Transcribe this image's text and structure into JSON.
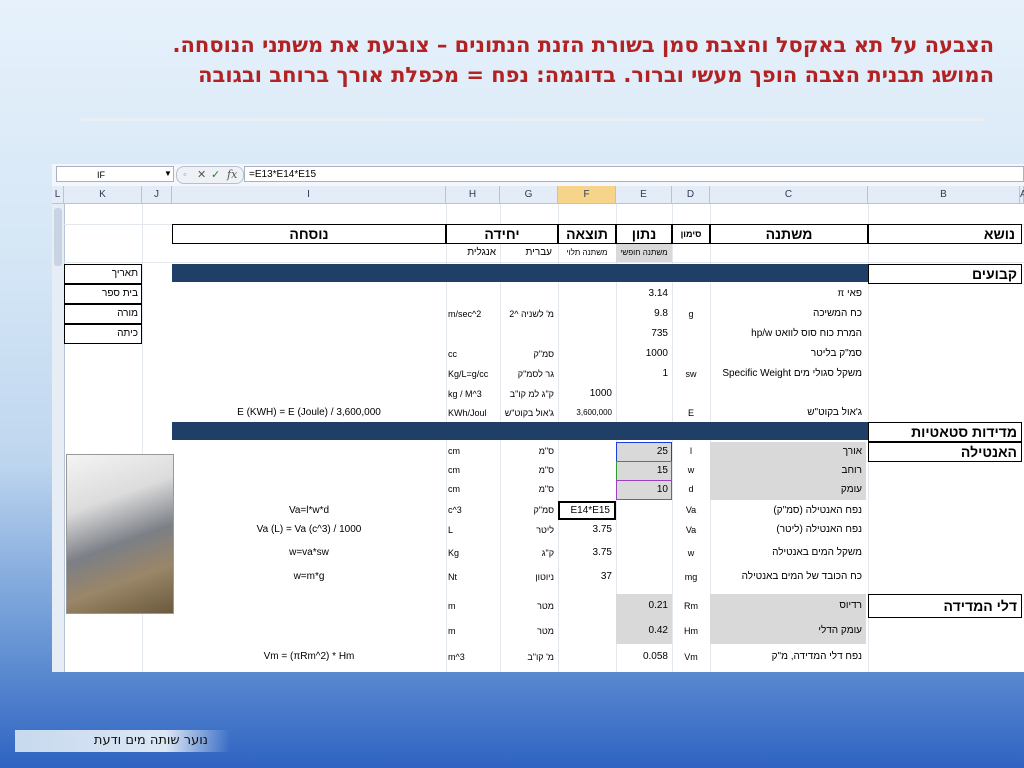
{
  "slide": {
    "title_line1": "הצבעה על תא באקסל והצבת סמן בשורת הזנת הנתונים – צובעת את משתני הנוסחה.",
    "title_line2": "המושג תבנית הצבה הופך מעשי וברור. בדוגמה: נפח = מכפלת אורך ברוחב ובגובה",
    "footer": "נוער שותה מים ודעת",
    "accent_title_color": "#b22222",
    "band_color": "#1f3f66"
  },
  "excel": {
    "name_box": "IF",
    "fx_buttons": [
      "✕",
      "✓",
      "fx"
    ],
    "formula": "=E13*E14*E15",
    "columns": [
      "L",
      "K",
      "J",
      "I",
      "H",
      "G",
      "F",
      "E",
      "D",
      "C",
      "B",
      "A"
    ],
    "headers": {
      "formula": "נוסחה",
      "unit": "יחידה",
      "result": "תוצאה",
      "datum": "נתון",
      "symbol": "סימון",
      "variable": "משתנה",
      "topic": "נושא"
    },
    "subheaders": {
      "english": "אנגלית",
      "hebrew": "עברית",
      "dependent": "משתנה תלוי",
      "free": "משתנה חופשי"
    },
    "side_labels": [
      "תאריך",
      "בית ספר",
      "מורה",
      "כיתה"
    ],
    "topics": {
      "constants": "קבועים",
      "static": "מדידות סטאטיות",
      "antila": "האנטילה",
      "bucket": "דלי המדידה"
    },
    "rows": [
      {
        "variable": "פאי   π",
        "symbol": "",
        "datum": "3.14",
        "result": "",
        "heb": "",
        "eng": "",
        "formula": ""
      },
      {
        "variable": "כח המשיכה",
        "symbol": "g",
        "datum": "9.8",
        "result": "",
        "heb": "מ' לשניה ^2",
        "eng": "m/sec^2",
        "formula": ""
      },
      {
        "variable": "המרת כוח סוס לוואט hp/w",
        "symbol": "",
        "datum": "735",
        "result": "",
        "heb": "",
        "eng": "",
        "formula": ""
      },
      {
        "variable": "סמ\"ק בליטר",
        "symbol": "",
        "datum": "1000",
        "result": "",
        "heb": "סמ\"ק",
        "eng": "cc",
        "formula": ""
      },
      {
        "variable": "משקל סגולי מים Specific Weight",
        "symbol": "sw",
        "datum": "1",
        "result": "",
        "heb": "גר לסמ\"ק",
        "eng": "Kg/L=g/cc",
        "formula": ""
      },
      {
        "variable": "",
        "symbol": "",
        "datum": "",
        "result": "1000",
        "heb": "ק\"ג למ קו\"ב",
        "eng": "kg / M^3",
        "formula": ""
      },
      {
        "variable": "ג'אול בקוט\"ש",
        "symbol": "E",
        "datum": "",
        "result": "3,600,000",
        "heb": "ג'אול בקוט\"ש",
        "eng": "KWh/Joul",
        "formula": "E (KWH) = E (Joule) / 3,600,000"
      },
      {
        "variable": "אורך",
        "symbol": "l",
        "datum": "25",
        "result": "",
        "heb": "ס\"מ",
        "eng": "cm",
        "formula": ""
      },
      {
        "variable": "רוחב",
        "symbol": "w",
        "datum": "15",
        "result": "",
        "heb": "ס\"מ",
        "eng": "cm",
        "formula": ""
      },
      {
        "variable": "עומק",
        "symbol": "d",
        "datum": "10",
        "result": "",
        "heb": "ס\"מ",
        "eng": "cm",
        "formula": ""
      },
      {
        "variable": "נפח האנטילה (סמ\"ק)",
        "symbol": "Va",
        "datum": "",
        "result": "E14*E15",
        "heb": "סמ\"ק",
        "eng": "c^3",
        "formula": "Va=l*w*d"
      },
      {
        "variable": "נפח האנטילה (ליטר)",
        "symbol": "Va",
        "datum": "",
        "result": "3.75",
        "heb": "ליטר",
        "eng": "L",
        "formula": "Va (L) = Va (c^3) / 1000"
      },
      {
        "variable": "משקל המים באנטילה",
        "symbol": "w",
        "datum": "",
        "result": "3.75",
        "heb": "ק\"ג",
        "eng": "Kg",
        "formula": "w=va*sw"
      },
      {
        "variable": "כח הכובד של המים באנטילה",
        "symbol": "mg",
        "datum": "",
        "result": "37",
        "heb": "ניוטון",
        "eng": "Nt",
        "formula": "w=m*g"
      },
      {
        "variable": "רדיוס",
        "symbol": "Rm",
        "datum": "0.21",
        "result": "",
        "heb": "מטר",
        "eng": "m",
        "formula": ""
      },
      {
        "variable": "עומק הדלי",
        "symbol": "Hm",
        "datum": "0.42",
        "result": "",
        "heb": "מטר",
        "eng": "m",
        "formula": ""
      },
      {
        "variable": "נפח דלי המדידה, מ\"ק",
        "symbol": "Vm",
        "datum": "0.058",
        "result": "",
        "heb": "מ' קו\"ב",
        "eng": "m^3",
        "formula": "Vm  =    (πRm^2) * Hm"
      }
    ]
  }
}
